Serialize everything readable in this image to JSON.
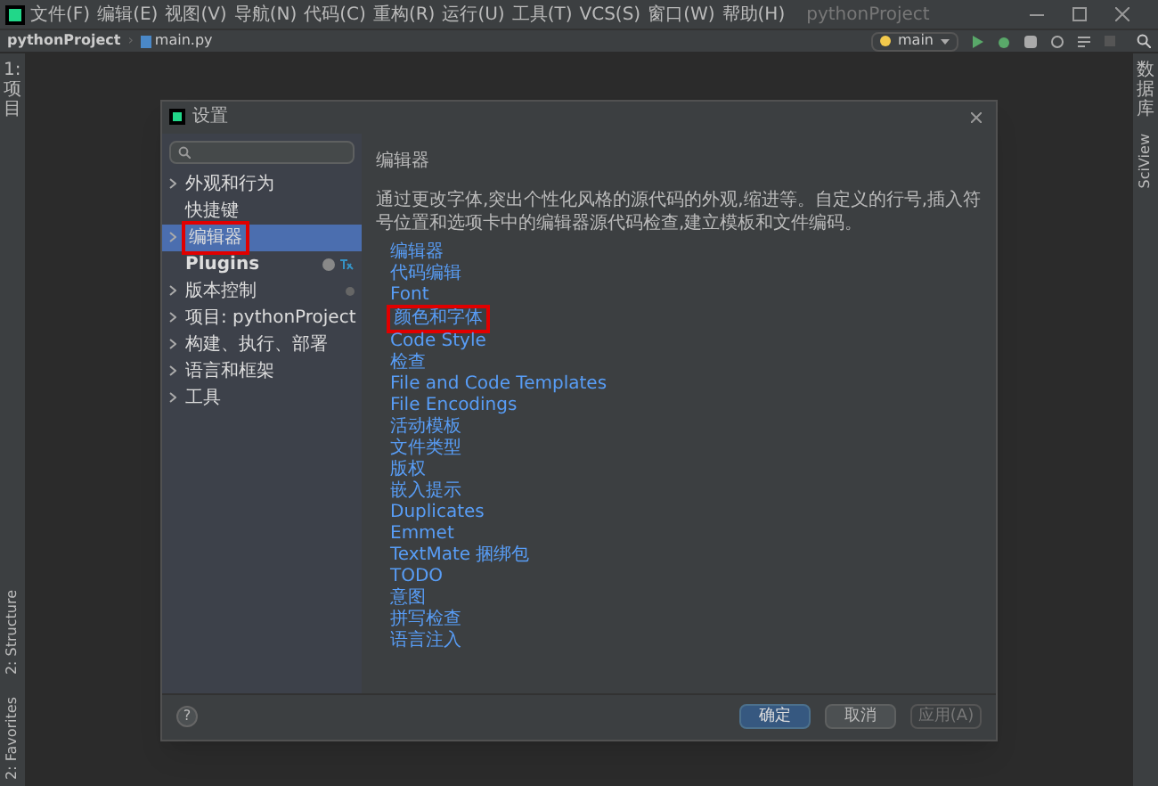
{
  "menu_bar": {
    "items": [
      "文件(F)",
      "编辑(E)",
      "视图(V)",
      "导航(N)",
      "代码(C)",
      "重构(R)",
      "运行(U)",
      "工具(T)",
      "VCS(S)",
      "窗口(W)",
      "帮助(H)"
    ],
    "title": "pythonProject"
  },
  "breadcrumb": [
    "pythonProject",
    "main.py"
  ],
  "breadcrumb_separator": "›",
  "help_button": "?",
  "run_config": {
    "label": "main"
  },
  "left_tool_windows": [
    {
      "label": "1: 项目",
      "kind": "cjk"
    },
    {
      "label": "2: Structure",
      "kind": "latin"
    },
    {
      "label": "2: Favorites",
      "kind": "latin"
    }
  ],
  "right_tool_windows": [
    {
      "label": "数据库",
      "kind": "cjk"
    },
    {
      "label": "SciView",
      "kind": "latin"
    }
  ],
  "dialog": {
    "title": "设置",
    "sidebar": [
      {
        "label": "外观和行为",
        "expandable": true,
        "selected": false,
        "highlighted": false,
        "bold": false,
        "kind": "plain"
      },
      {
        "label": "快捷键",
        "expandable": false,
        "selected": false,
        "highlighted": false,
        "bold": false,
        "kind": "plain"
      },
      {
        "label": "编辑器",
        "expandable": true,
        "selected": true,
        "highlighted": true,
        "bold": false,
        "kind": "plain"
      },
      {
        "label": "Plugins",
        "expandable": false,
        "selected": false,
        "highlighted": false,
        "bold": true,
        "kind": "plugins"
      },
      {
        "label": "版本控制",
        "expandable": true,
        "selected": false,
        "highlighted": false,
        "bold": false,
        "kind": "scope"
      },
      {
        "label": "项目: pythonProject",
        "expandable": true,
        "selected": false,
        "highlighted": false,
        "bold": false,
        "kind": "scope"
      },
      {
        "label": "构建、执行、部署",
        "expandable": true,
        "selected": false,
        "highlighted": false,
        "bold": false,
        "kind": "plain"
      },
      {
        "label": "语言和框架",
        "expandable": true,
        "selected": false,
        "highlighted": false,
        "bold": false,
        "kind": "plain"
      },
      {
        "label": "工具",
        "expandable": true,
        "selected": false,
        "highlighted": false,
        "bold": false,
        "kind": "plain"
      }
    ],
    "heading": "编辑器",
    "description": "通过更改字体,突出个性化风格的源代码的外观,缩进等。自定义的行号,插入符号位置和选项卡中的编辑器源代码检查,建立模板和文件编码。",
    "links": [
      {
        "label": "编辑器",
        "highlighted": false
      },
      {
        "label": "代码编辑",
        "highlighted": false
      },
      {
        "label": "Font",
        "highlighted": false
      },
      {
        "label": "颜色和字体",
        "highlighted": true
      },
      {
        "label": "Code Style",
        "highlighted": false
      },
      {
        "label": "检查",
        "highlighted": false
      },
      {
        "label": "File and Code Templates",
        "highlighted": false
      },
      {
        "label": "File Encodings",
        "highlighted": false
      },
      {
        "label": "活动模板",
        "highlighted": false
      },
      {
        "label": "文件类型",
        "highlighted": false
      },
      {
        "label": "版权",
        "highlighted": false
      },
      {
        "label": "嵌入提示",
        "highlighted": false
      },
      {
        "label": "Duplicates",
        "highlighted": false
      },
      {
        "label": "Emmet",
        "highlighted": false
      },
      {
        "label": "TextMate 捆绑包",
        "highlighted": false
      },
      {
        "label": "TODO",
        "highlighted": false
      },
      {
        "label": "意图",
        "highlighted": false
      },
      {
        "label": "拼写检查",
        "highlighted": false
      },
      {
        "label": "语言注入",
        "highlighted": false
      }
    ],
    "buttons": [
      {
        "label": "确定",
        "kind": "primary"
      },
      {
        "label": "取消",
        "kind": "normal"
      },
      {
        "label": "应用(A)",
        "kind": "disabled"
      }
    ]
  }
}
